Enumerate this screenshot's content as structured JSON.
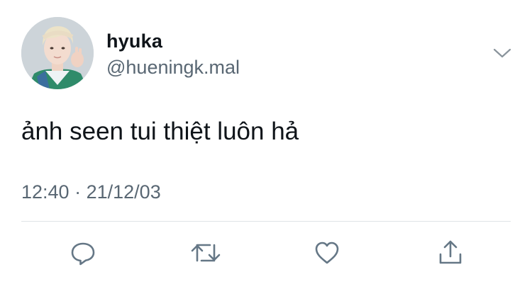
{
  "tweet": {
    "display_name": "hyuka",
    "handle": "@hueningk.mal",
    "text": "ảnh seen tui thiệt luôn hả",
    "time": "12:40",
    "separator": "·",
    "date": "21/12/03"
  },
  "icons": {
    "menu": "chevron-down-icon",
    "reply": "reply-icon",
    "retweet": "retweet-icon",
    "like": "heart-icon",
    "share": "share-icon"
  },
  "colors": {
    "text": "#0f1419",
    "secondary": "#596773",
    "icon": "#657786",
    "divider": "#dfe3e6"
  }
}
